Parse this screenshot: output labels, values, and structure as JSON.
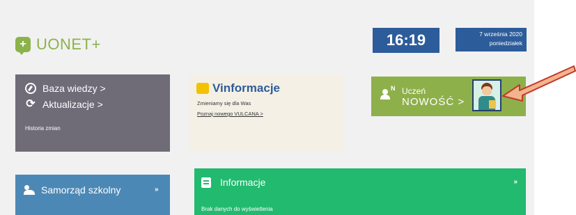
{
  "brand": {
    "name": "UONET+",
    "icon": "speech-bubble-plus-icon"
  },
  "header": {
    "time": "16:19",
    "date_line1": "7 września 2020",
    "date_line2": "poniedziałek"
  },
  "tiles": {
    "knowledge": {
      "label": "Baza wiedzy >",
      "icon": "compass-icon"
    },
    "updates": {
      "label": "Aktualizacje >",
      "icon": "refresh-icon",
      "history": "Historia zmian"
    },
    "council": {
      "label": "Samorząd szkolny",
      "chevron": "»",
      "icon": "users-icon"
    },
    "vinformacje": {
      "title": "Vinformacje",
      "subtitle": "Zmieniamy się dla Was",
      "link": "Poznaj nowego VULCANA >",
      "icon": "speech-bubble-icon"
    },
    "student": {
      "badge": "N",
      "line1": "Uczeń",
      "line2": "NOWOŚĆ >",
      "icon": "student-icon"
    },
    "info": {
      "title": "Informacje",
      "empty": "Brak danych do wyświetlenia",
      "chevron": "»",
      "icon": "document-icon"
    }
  },
  "colors": {
    "accent": "#8cb24a",
    "header_blue": "#2d5c9a",
    "info_green": "#21ba6f",
    "council_blue": "#4c88b5",
    "grey_tile": "#6f6b77"
  }
}
